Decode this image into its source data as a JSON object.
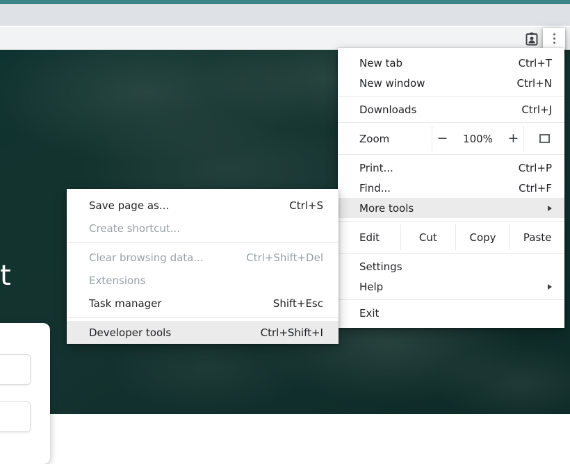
{
  "browser": {
    "accent_color": "#3d8487",
    "tabstrip_color": "#dee1e6",
    "toolbar_color": "#f1f3f4",
    "profile_icon": "id-badge-icon",
    "menu_icon": "three-dots-vertical-icon"
  },
  "page": {
    "title_fragment": "t",
    "background_color": "#103330"
  },
  "main_menu": {
    "groups": [
      {
        "items": [
          {
            "label": "New tab",
            "accel": "Ctrl+T",
            "name": "new-tab"
          },
          {
            "label": "New window",
            "accel": "Ctrl+N",
            "name": "new-window"
          }
        ]
      },
      {
        "items": [
          {
            "label": "Downloads",
            "accel": "Ctrl+J",
            "name": "downloads"
          }
        ]
      },
      {
        "items": [
          {
            "label": "Print...",
            "accel": "Ctrl+P",
            "name": "print"
          },
          {
            "label": "Find...",
            "accel": "Ctrl+F",
            "name": "find"
          },
          {
            "label": "More tools",
            "accel": "",
            "name": "more-tools",
            "highlighted": true,
            "submenu": true
          }
        ]
      },
      {
        "items": [
          {
            "label": "Settings",
            "accel": "",
            "name": "settings"
          },
          {
            "label": "Help",
            "accel": "",
            "name": "help",
            "submenu": true
          }
        ]
      },
      {
        "items": [
          {
            "label": "Exit",
            "accel": "",
            "name": "exit"
          }
        ]
      }
    ],
    "zoom": {
      "label": "Zoom",
      "minus": "−",
      "level": "100%",
      "plus": "+",
      "fullscreen_icon": "fullscreen-icon"
    },
    "edit": {
      "label": "Edit",
      "actions": [
        "Cut",
        "Copy",
        "Paste"
      ]
    }
  },
  "more_tools_submenu": {
    "items": [
      {
        "label": "Save page as...",
        "accel": "Ctrl+S",
        "name": "save-page-as",
        "disabled": false
      },
      {
        "label": "Create shortcut...",
        "accel": "",
        "name": "create-shortcut",
        "disabled": true
      },
      {
        "label": "Clear browsing data...",
        "accel": "Ctrl+Shift+Del",
        "name": "clear-browsing-data",
        "disabled": true
      },
      {
        "label": "Extensions",
        "accel": "",
        "name": "extensions",
        "disabled": true
      },
      {
        "label": "Task manager",
        "accel": "Shift+Esc",
        "name": "task-manager",
        "disabled": false
      },
      {
        "label": "Developer tools",
        "accel": "Ctrl+Shift+I",
        "name": "developer-tools",
        "disabled": false,
        "highlighted": true
      }
    ]
  }
}
